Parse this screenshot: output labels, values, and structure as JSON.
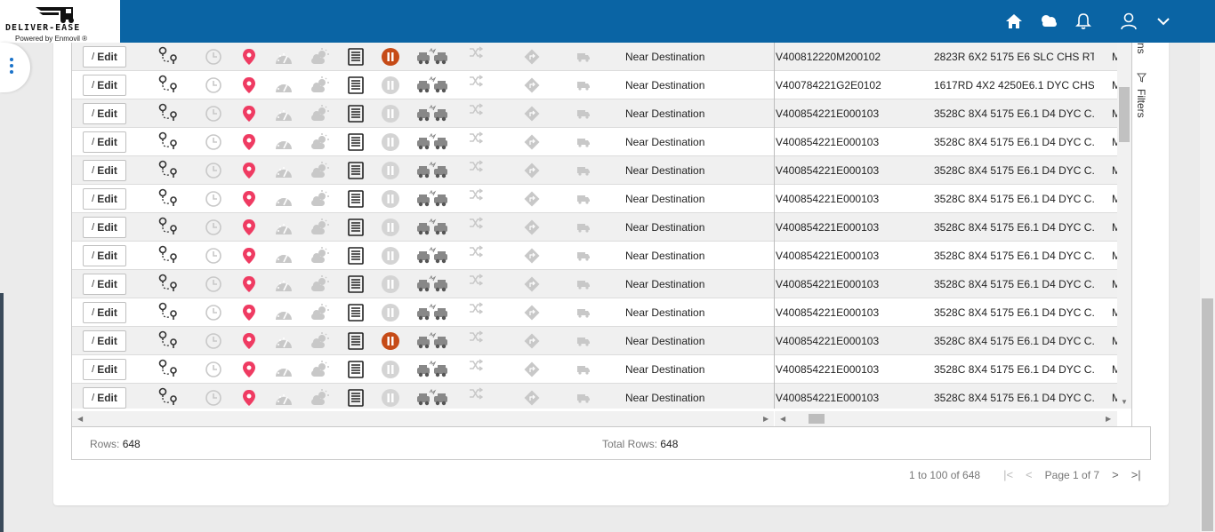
{
  "header": {
    "logo_text": "DELIVER-EASE",
    "logo_sub": "Powered by Enmovil ®",
    "icons": [
      "home-icon",
      "weather-icon",
      "bell-icon",
      "user-icon",
      "chevron-down-icon"
    ]
  },
  "colors": {
    "header": "#0a64a4",
    "pin": "#ef3b62",
    "pause_active": "#c64b17",
    "inactive": "#c8c8c8"
  },
  "grid": {
    "edit_label": "Edit",
    "rows": [
      {
        "status": "Near Destination",
        "vin": "V400812220M200102",
        "desc": "2823R 6X2 5175 E6 SLC CHS RT...",
        "m": "M",
        "paused": true
      },
      {
        "status": "Near Destination",
        "vin": "V400784221G2E0102",
        "desc": "1617RD 4X2 4250E6.1 DYC CHS...",
        "m": "M",
        "paused": false
      },
      {
        "status": "Near Destination",
        "vin": "V400854221E000103",
        "desc": "3528C 8X4 5175 E6.1 D4 DYC C...",
        "m": "M",
        "paused": false
      },
      {
        "status": "Near Destination",
        "vin": "V400854221E000103",
        "desc": "3528C 8X4 5175 E6.1 D4 DYC C...",
        "m": "M",
        "paused": false
      },
      {
        "status": "Near Destination",
        "vin": "V400854221E000103",
        "desc": "3528C 8X4 5175 E6.1 D4 DYC C...",
        "m": "M",
        "paused": false
      },
      {
        "status": "Near Destination",
        "vin": "V400854221E000103",
        "desc": "3528C 8X4 5175 E6.1 D4 DYC C...",
        "m": "M",
        "paused": false
      },
      {
        "status": "Near Destination",
        "vin": "V400854221E000103",
        "desc": "3528C 8X4 5175 E6.1 D4 DYC C...",
        "m": "M",
        "paused": false
      },
      {
        "status": "Near Destination",
        "vin": "V400854221E000103",
        "desc": "3528C 8X4 5175 E6.1 D4 DYC C...",
        "m": "M",
        "paused": false
      },
      {
        "status": "Near Destination",
        "vin": "V400854221E000103",
        "desc": "3528C 8X4 5175 E6.1 D4 DYC C...",
        "m": "M",
        "paused": false
      },
      {
        "status": "Near Destination",
        "vin": "V400854221E000103",
        "desc": "3528C 8X4 5175 E6.1 D4 DYC C...",
        "m": "M",
        "paused": false
      },
      {
        "status": "Near Destination",
        "vin": "V400854221E000103",
        "desc": "3528C 8X4 5175 E6.1 D4 DYC C...",
        "m": "M",
        "paused": true
      },
      {
        "status": "Near Destination",
        "vin": "V400854221E000103",
        "desc": "3528C 8X4 5175 E6.1 D4 DYC C...",
        "m": "M",
        "paused": false
      },
      {
        "status": "Near Destination",
        "vin": "V400854221E000103",
        "desc": "3528C 8X4 5175 E6.1 D4 DYC C...",
        "m": "M",
        "paused": false
      }
    ],
    "tool_panel": {
      "columns_label": "ns",
      "filters_label": "Filters"
    }
  },
  "statusbar": {
    "rows_label": "Rows:",
    "rows_value": "648",
    "total_label": "Total Rows:",
    "total_value": "648"
  },
  "pager": {
    "range": "1 to 100 of 648",
    "page_label": "Page",
    "page_current": "1",
    "page_of": "of",
    "page_total": "7"
  }
}
